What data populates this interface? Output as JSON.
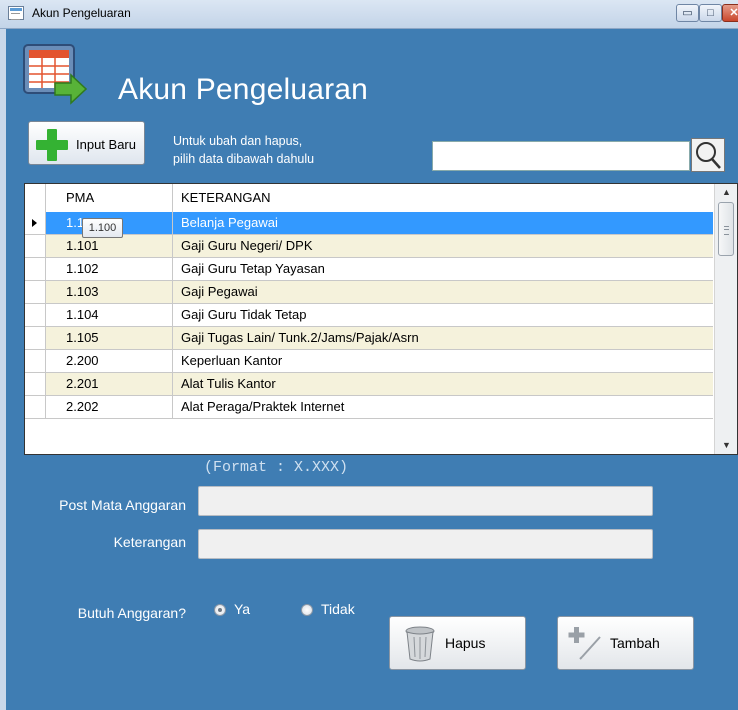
{
  "window": {
    "title": "Akun Pengeluaran"
  },
  "header": {
    "title": "Akun Pengeluaran"
  },
  "toolbar": {
    "input_baru_label": "Input Baru",
    "hint_line1": "Untuk ubah dan hapus,",
    "hint_line2": "pilih data dibawah dahulu",
    "search_value": ""
  },
  "grid": {
    "columns": [
      "PMA",
      "KETERANGAN"
    ],
    "rows": [
      {
        "pma": "1.100",
        "ket": "Belanja Pegawai"
      },
      {
        "pma": "1.101",
        "ket": "Gaji Guru Negeri/ DPK"
      },
      {
        "pma": "1.102",
        "ket": "Gaji Guru Tetap Yayasan"
      },
      {
        "pma": "1.103",
        "ket": "Gaji Pegawai"
      },
      {
        "pma": "1.104",
        "ket": "Gaji Guru Tidak Tetap"
      },
      {
        "pma": "1.105",
        "ket": "Gaji Tugas Lain/ Tunk.2/Jams/Pajak/Asrn"
      },
      {
        "pma": "2.200",
        "ket": "Keperluan Kantor"
      },
      {
        "pma": "2.201",
        "ket": "Alat Tulis Kantor"
      },
      {
        "pma": "2.202",
        "ket": "Alat Peraga/Praktek Internet"
      }
    ],
    "selected_row": 0,
    "tooltip": "1.100"
  },
  "form": {
    "format_hint": "(Format : X.XXX)",
    "pma_label": "Post Mata Anggaran",
    "pma_value": "",
    "ket_label": "Keterangan",
    "ket_value": "",
    "butuh_label": "Butuh Anggaran?",
    "radio_ya": "Ya",
    "radio_tidak": "Tidak",
    "butuh_selected": "Ya"
  },
  "buttons": {
    "hapus": "Hapus",
    "tambah": "Tambah"
  },
  "colors": {
    "background": "#3f7db3",
    "selection": "#3399ff",
    "alt_row": "#f5f2dc",
    "plus_green": "#34b233"
  }
}
